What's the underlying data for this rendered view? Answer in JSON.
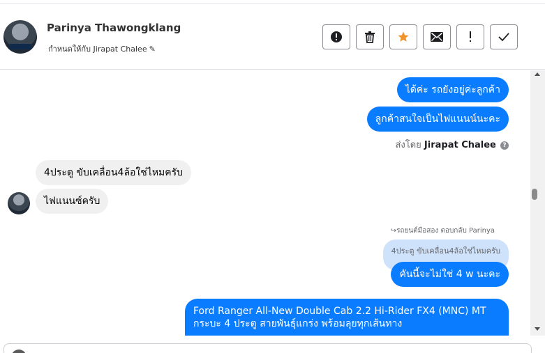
{
  "header": {
    "name": "Parinya Thawongklang",
    "assigned_label": "กำหนดให้กับ Jirapat Chalee",
    "pencil_icon": "✎"
  },
  "actions": [
    {
      "name": "spam-button",
      "icon": "exclamation-circle-icon"
    },
    {
      "name": "delete-button",
      "icon": "trash-icon"
    },
    {
      "name": "star-button",
      "icon": "star-icon",
      "color": "#f0932b"
    },
    {
      "name": "mark-unread-button",
      "icon": "envelope-icon"
    },
    {
      "name": "follow-up-button",
      "icon": "exclamation-icon"
    },
    {
      "name": "mark-done-button",
      "icon": "check-icon"
    }
  ],
  "messages": {
    "out1": "ได้ค่ะ รถยังอยู่ค่ะลูกค้า",
    "out2": "ลูกค้าสนใจเป็นไฟแนนน์นะคะ",
    "sent_by_prefix": "ส่งโดย",
    "sent_by_name": "Jirapat Chalee",
    "in1": "4ประตู ขับเคลื่อน4ล้อใช่ไหมครับ",
    "in2": "ไฟแนนซ์ครับ",
    "reply_label": "รถยนต์มือสอง ตอบกลับ Parinya",
    "reply_quote": "4ประตู ขับเคลื่อน4ล้อใช่ไหมครับ",
    "out3": "คันนี้จะไม่ใช่ 4 w นะคะ",
    "out4_line1": "Ford Ranger All-New Double Cab 2.2 Hi-Rider FX4 (MNC) MT",
    "out4_line2": "กระบะ 4 ประตู สายพันธุ์แกร่ง พร้อมลุยทุกเส้นทาง"
  },
  "colors": {
    "outgoing_bubble": "#0a7cff",
    "incoming_bubble": "#f0f0f0",
    "star": "#f0932b"
  }
}
